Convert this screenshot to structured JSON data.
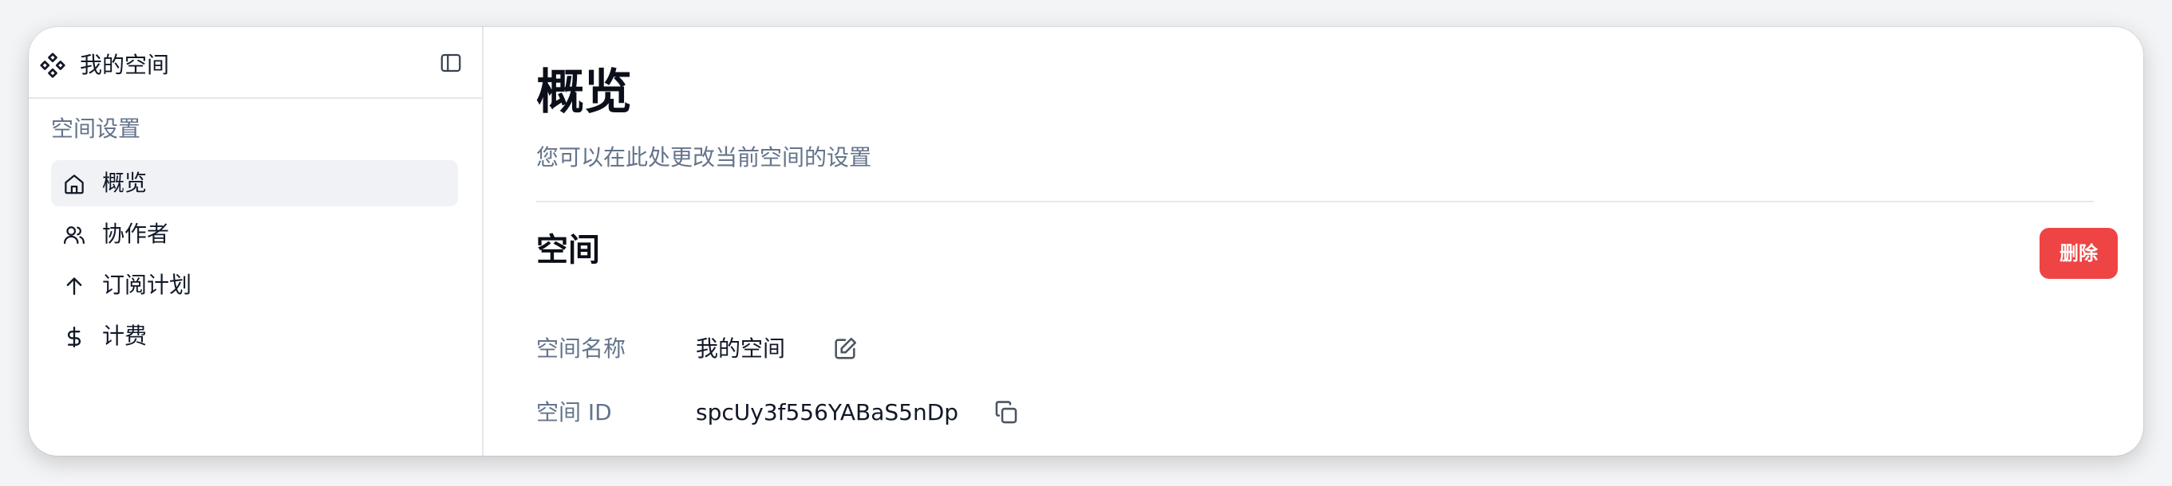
{
  "sidebar": {
    "workspace_name": "我的空间",
    "section_title": "空间设置",
    "items": [
      {
        "label": "概览",
        "icon": "home-icon",
        "active": true
      },
      {
        "label": "协作者",
        "icon": "users-icon",
        "active": false
      },
      {
        "label": "订阅计划",
        "icon": "arrow-up-icon",
        "active": false
      },
      {
        "label": "计费",
        "icon": "dollar-icon",
        "active": false
      }
    ]
  },
  "main": {
    "title": "概览",
    "subtitle": "您可以在此处更改当前空间的设置",
    "section": {
      "heading": "空间",
      "delete_label": "删除",
      "fields": [
        {
          "label": "空间名称",
          "value": "我的空间",
          "action_icon": "edit-icon"
        },
        {
          "label": "空间 ID",
          "value": "spcUy3f556YABaS5nDp",
          "action_icon": "copy-icon"
        }
      ]
    }
  },
  "colors": {
    "danger": "#ef4444",
    "muted_text": "#64748b",
    "active_bg": "#f1f2f5",
    "border": "#e5e7eb"
  }
}
